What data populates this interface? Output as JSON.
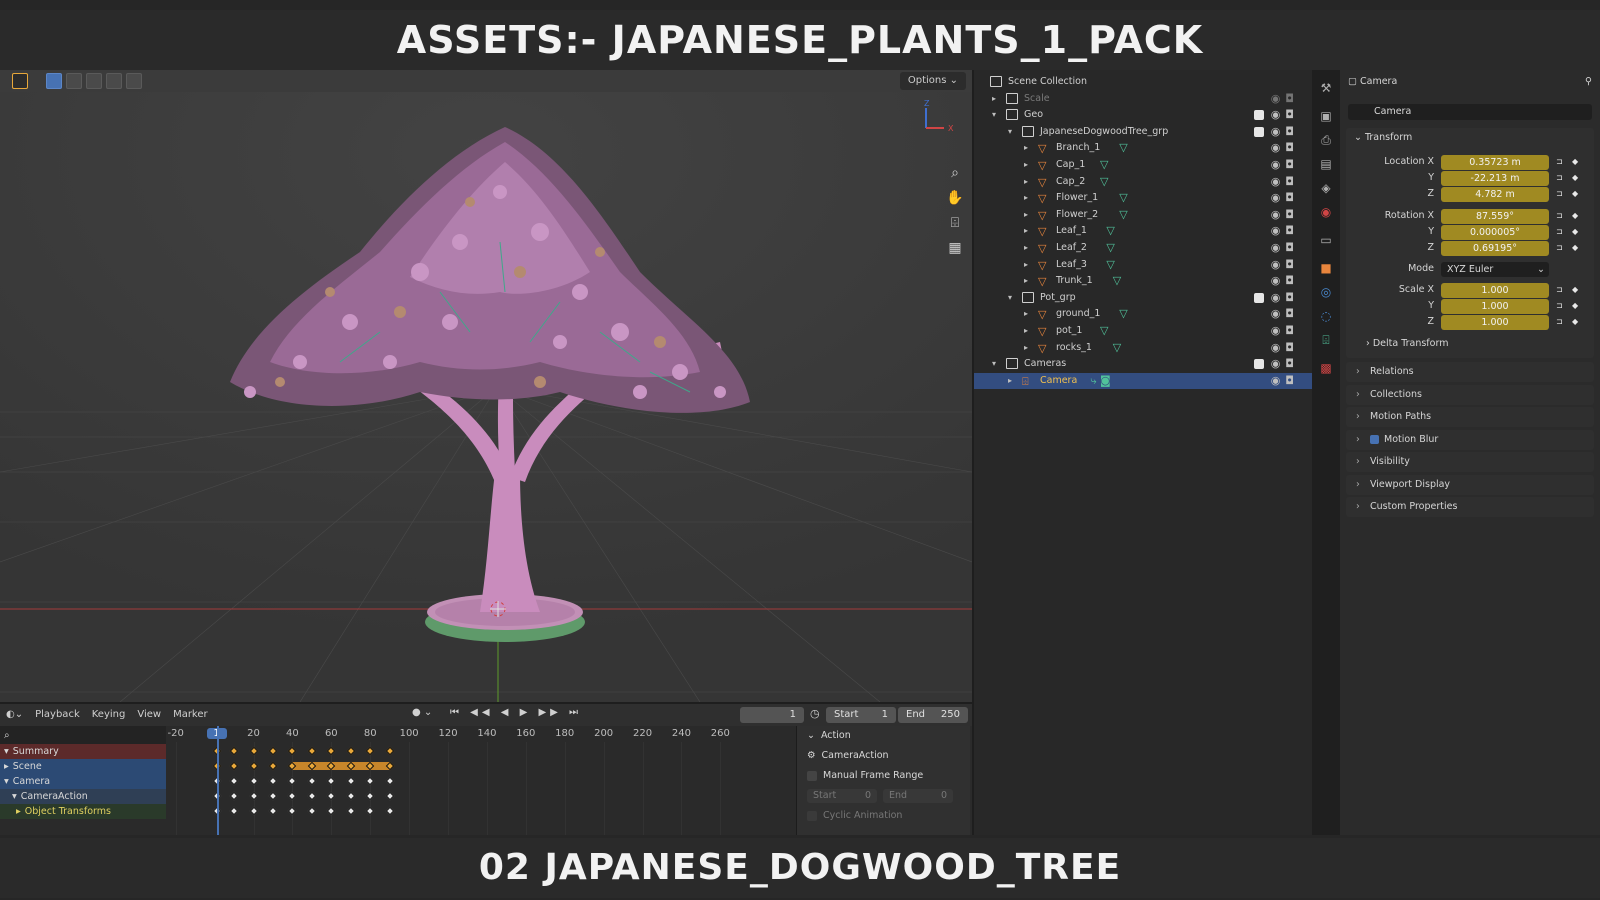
{
  "banners": {
    "top": "ASSETS:- JAPANESE_PLANTS_1_PACK",
    "bottom": "02 JAPANESE_DOGWOOD_TREE"
  },
  "viewport": {
    "options_label": "Options",
    "gizmo_axes": [
      "Z",
      "X"
    ],
    "tools": [
      "zoom-icon",
      "hand-icon",
      "camera-icon",
      "grid-icon"
    ]
  },
  "timeline": {
    "menu": [
      "Playback",
      "Keying",
      "View",
      "Marker"
    ],
    "current_frame": "1",
    "start_label": "Start",
    "start_value": "1",
    "end_label": "End",
    "end_value": "250",
    "ticks": [
      "-20",
      "1",
      "20",
      "40",
      "60",
      "80",
      "100",
      "120",
      "140",
      "160",
      "180",
      "200",
      "220",
      "240",
      "260"
    ],
    "channels": [
      "Summary",
      "Scene",
      "Camera",
      "CameraAction",
      "Object Transforms"
    ],
    "keyframes": [
      1,
      10,
      20,
      30,
      40,
      50,
      60,
      70,
      80,
      90
    ]
  },
  "action_panel": {
    "title": "Action",
    "action_name": "CameraAction",
    "manual_range": "Manual Frame Range",
    "start_label": "Start",
    "start_value": "0",
    "end_label": "End",
    "end_value": "0",
    "cyclic": "Cyclic Animation"
  },
  "outliner": {
    "rows": [
      {
        "label": "Scene Collection",
        "depth": 0,
        "kind": "scene"
      },
      {
        "label": "Scale",
        "depth": 1,
        "kind": "collection",
        "dim": true
      },
      {
        "label": "Geo",
        "depth": 1,
        "kind": "collection"
      },
      {
        "label": "JapaneseDogwoodTree_grp",
        "depth": 2,
        "kind": "collection"
      },
      {
        "label": "Branch_1",
        "depth": 3,
        "kind": "mesh"
      },
      {
        "label": "Cap_1",
        "depth": 3,
        "kind": "mesh"
      },
      {
        "label": "Cap_2",
        "depth": 3,
        "kind": "mesh"
      },
      {
        "label": "Flower_1",
        "depth": 3,
        "kind": "mesh"
      },
      {
        "label": "Flower_2",
        "depth": 3,
        "kind": "mesh"
      },
      {
        "label": "Leaf_1",
        "depth": 3,
        "kind": "mesh"
      },
      {
        "label": "Leaf_2",
        "depth": 3,
        "kind": "mesh"
      },
      {
        "label": "Leaf_3",
        "depth": 3,
        "kind": "mesh"
      },
      {
        "label": "Trunk_1",
        "depth": 3,
        "kind": "mesh"
      },
      {
        "label": "Pot_grp",
        "depth": 2,
        "kind": "collection"
      },
      {
        "label": "ground_1",
        "depth": 3,
        "kind": "mesh"
      },
      {
        "label": "pot_1",
        "depth": 3,
        "kind": "mesh"
      },
      {
        "label": "rocks_1",
        "depth": 3,
        "kind": "mesh"
      },
      {
        "label": "Cameras",
        "depth": 1,
        "kind": "collection"
      },
      {
        "label": "Camera",
        "depth": 2,
        "kind": "camera",
        "selected": true
      }
    ]
  },
  "properties": {
    "header": "Camera",
    "object_name": "Camera",
    "transform_title": "Transform",
    "location": {
      "label_x": "Location X",
      "x": "0.35723 m",
      "y": "-22.213 m",
      "z": "4.782 m"
    },
    "rotation": {
      "label_x": "Rotation X",
      "x": "87.559°",
      "y": "0.000005°",
      "z": "0.69195°"
    },
    "mode_label": "Mode",
    "mode_value": "XYZ Euler",
    "scale": {
      "label_x": "Scale X",
      "x": "1.000",
      "y": "1.000",
      "z": "1.000"
    },
    "axis_y": "Y",
    "axis_z": "Z",
    "delta": "Delta Transform",
    "panels": [
      "Relations",
      "Collections",
      "Motion Paths",
      "Motion Blur",
      "Visibility",
      "Viewport Display",
      "Custom Properties"
    ]
  },
  "colors": {
    "accent_blue": "#4772b3",
    "field_yellow": "#a08a22",
    "keyframe_orange": "#e8a83a",
    "mesh_orange": "#e8853d",
    "data_green": "#51c29b",
    "selected_row": "#334d80"
  }
}
